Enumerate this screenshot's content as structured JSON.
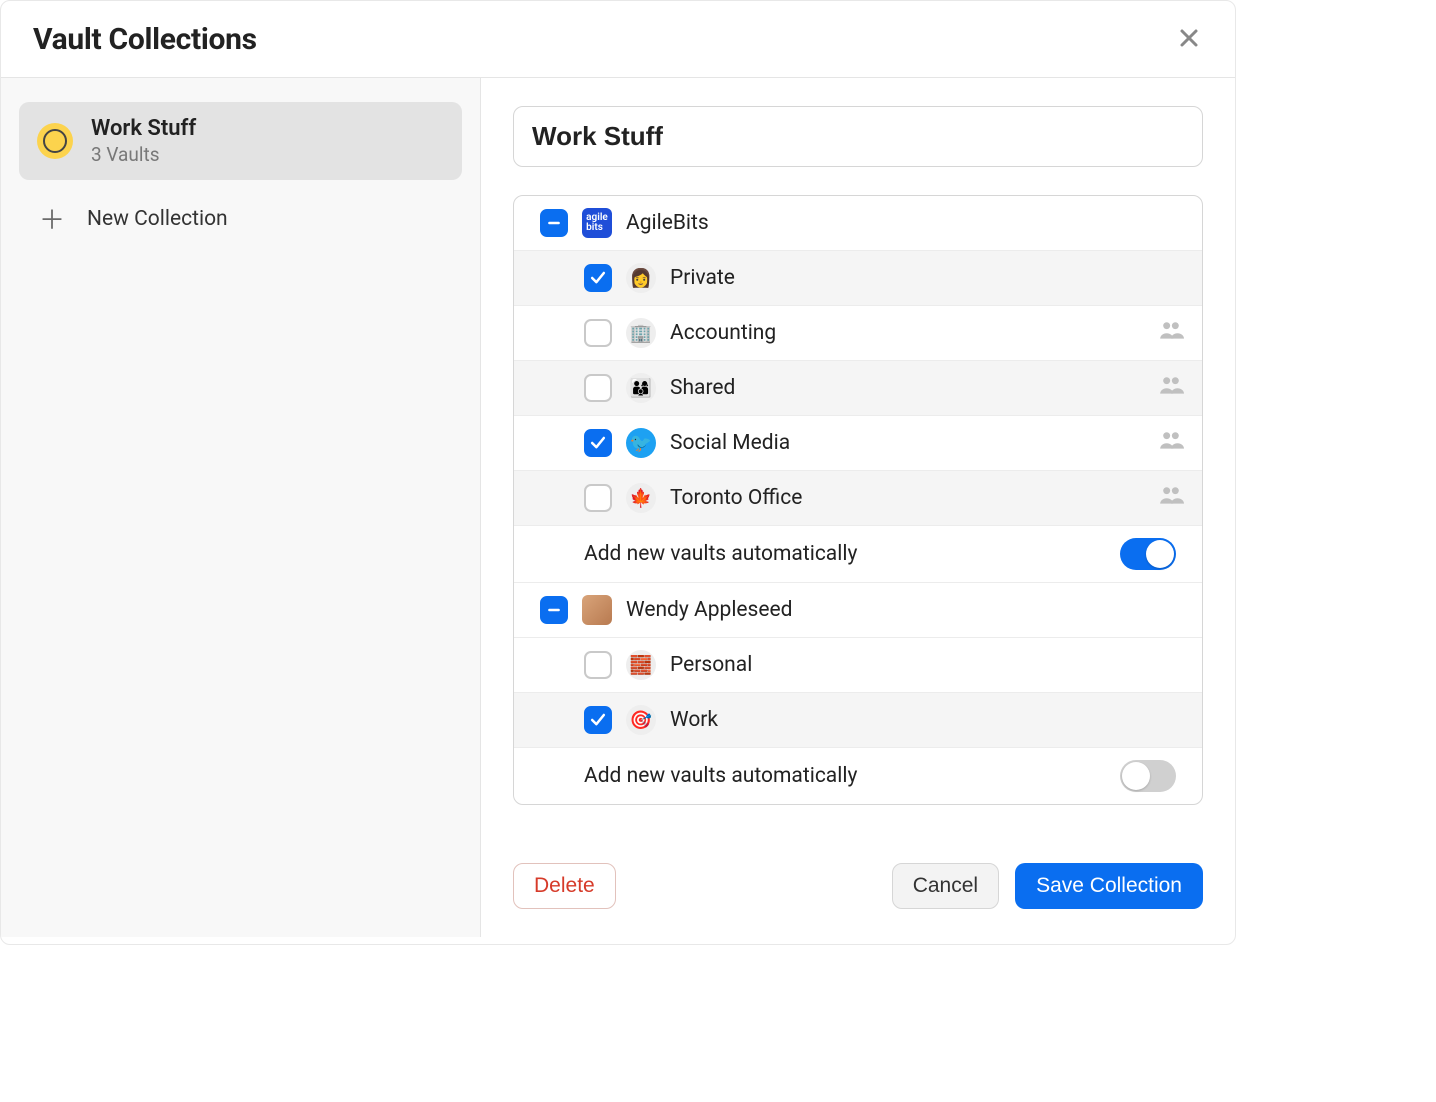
{
  "header": {
    "title": "Vault Collections"
  },
  "sidebar": {
    "collections": [
      {
        "name": "Work Stuff",
        "subtitle": "3 Vaults",
        "selected": true
      }
    ],
    "new_label": "New Collection"
  },
  "main": {
    "name_value": "Work Stuff",
    "auto_add_label": "Add new vaults automatically",
    "accounts": [
      {
        "name": "AgileBits",
        "state": "indeterminate",
        "icon": "agilebits-logo",
        "auto_add": true,
        "vaults": [
          {
            "name": "Private",
            "checked": true,
            "icon": "person-avatar",
            "shared": false,
            "alt": true
          },
          {
            "name": "Accounting",
            "checked": false,
            "icon": "building-icon",
            "shared": true,
            "alt": false
          },
          {
            "name": "Shared",
            "checked": false,
            "icon": "people-avatar",
            "shared": true,
            "alt": true
          },
          {
            "name": "Social Media",
            "checked": true,
            "icon": "twitter-icon",
            "shared": true,
            "alt": false
          },
          {
            "name": "Toronto Office",
            "checked": false,
            "icon": "maple-leaf-icon",
            "shared": true,
            "alt": true
          }
        ]
      },
      {
        "name": "Wendy Appleseed",
        "state": "indeterminate",
        "icon": "wendy-avatar",
        "auto_add": false,
        "vaults": [
          {
            "name": "Personal",
            "checked": false,
            "icon": "brick-icon",
            "shared": false,
            "alt": false
          },
          {
            "name": "Work",
            "checked": true,
            "icon": "target-icon",
            "shared": false,
            "alt": true
          }
        ]
      }
    ]
  },
  "footer": {
    "delete": "Delete",
    "cancel": "Cancel",
    "save": "Save Collection"
  },
  "icon_glyphs": {
    "person-avatar": "👩",
    "building-icon": "🏢",
    "people-avatar": "👨‍👩‍👦",
    "twitter-icon": "🐦",
    "maple-leaf-icon": "🍁",
    "brick-icon": "🧱",
    "target-icon": "🎯"
  }
}
